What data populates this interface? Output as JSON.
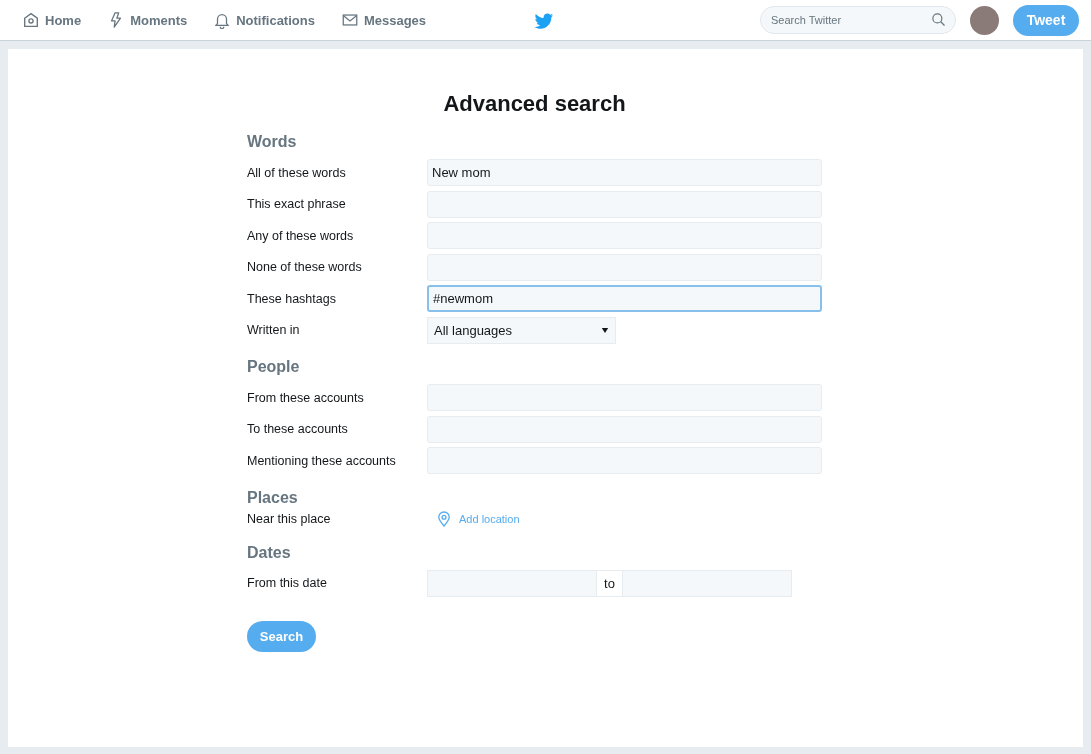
{
  "nav": {
    "items": [
      {
        "label": "Home",
        "kind": "home"
      },
      {
        "label": "Moments",
        "kind": "moments"
      },
      {
        "label": "Notifications",
        "kind": "notifications"
      },
      {
        "label": "Messages",
        "kind": "messages"
      }
    ],
    "search": {
      "placeholder": "Search Twitter"
    },
    "tweet_button": "Tweet"
  },
  "title": "Advanced search",
  "sections": [
    {
      "heading": "Words",
      "rows": [
        {
          "kind": "text",
          "label": "All of these words",
          "value": "New mom",
          "focused": false
        },
        {
          "kind": "text",
          "label": "This exact phrase",
          "focused": false
        },
        {
          "kind": "text",
          "label": "Any of these words",
          "focused": false
        },
        {
          "kind": "text",
          "label": "None of these words",
          "focused": false
        },
        {
          "kind": "text",
          "label": "These hashtags",
          "value": "#newmom",
          "focused": true
        },
        {
          "kind": "select",
          "label": "Written in",
          "value": "All languages"
        }
      ]
    },
    {
      "heading": "People",
      "rows": [
        {
          "kind": "text",
          "label": "From these accounts",
          "focused": false
        },
        {
          "kind": "text",
          "label": "To these accounts",
          "focused": false
        },
        {
          "kind": "text",
          "label": "Mentioning these accounts",
          "focused": false
        }
      ]
    },
    {
      "heading": "Places",
      "rows": [
        {
          "kind": "location",
          "label": "Near this place",
          "link": "Add location"
        }
      ]
    },
    {
      "heading": "Dates",
      "rows": [
        {
          "kind": "daterange",
          "label": "From this date",
          "separator": "to"
        }
      ]
    }
  ],
  "search_button": "Search"
}
